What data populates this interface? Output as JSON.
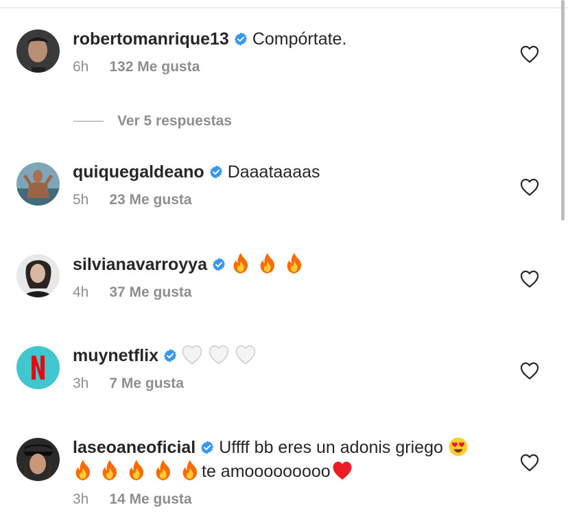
{
  "replies_label": "Ver 5 respuestas",
  "icons": {
    "verified": "verified-badge-icon",
    "like": "heart-outline-icon"
  },
  "colors": {
    "verified": "#3897f0",
    "meta": "#8e8e8e",
    "text": "#262626",
    "heart_red": "#ed1c24",
    "fire_orange": "#ff6a00",
    "netflix_red": "#e50914"
  },
  "comments": [
    {
      "username": "robertomanrique13",
      "text": "Compórtate.",
      "time": "6h",
      "likes": "132 Me gusta"
    },
    {
      "username": "quiquegaldeano",
      "text": "Daaataaaas",
      "time": "5h",
      "likes": "23 Me gusta"
    },
    {
      "username": "silvianavarroyya",
      "text": "",
      "emojis": [
        "fire",
        "fire",
        "fire"
      ],
      "time": "4h",
      "likes": "37 Me gusta"
    },
    {
      "username": "muynetflix",
      "text": "",
      "emojis": [
        "white-heart",
        "white-heart",
        "white-heart"
      ],
      "time": "3h",
      "likes": "7 Me gusta"
    },
    {
      "username": "laseoaneoficial",
      "text": "Uffff bb eres un adonis griego",
      "text_tail": "te amooooooooo",
      "emojis": [
        "heart-eyes",
        "fire",
        "fire",
        "fire",
        "fire",
        "fire",
        "red-heart"
      ],
      "time": "3h",
      "likes": "14 Me gusta"
    }
  ]
}
